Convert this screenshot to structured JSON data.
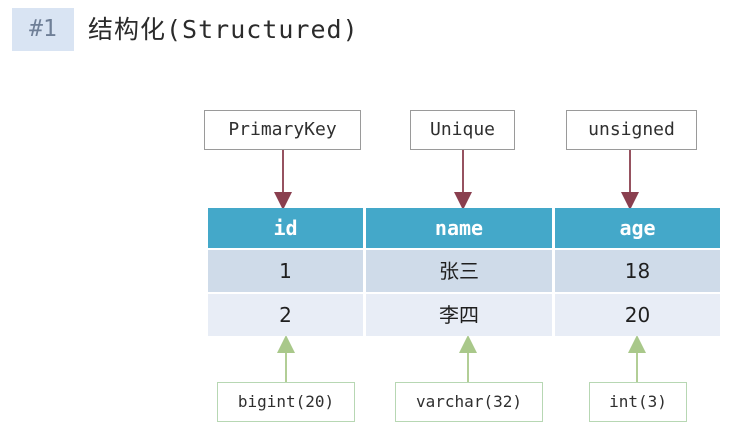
{
  "header": {
    "badge": "#1",
    "title": "结构化(Structured)"
  },
  "constraints": [
    "PrimaryKey",
    "Unique",
    "unsigned"
  ],
  "table": {
    "columns": [
      "id",
      "name",
      "age"
    ],
    "rows": [
      [
        "1",
        "张三",
        "18"
      ],
      [
        "2",
        "李四",
        "20"
      ]
    ]
  },
  "types": [
    "bigint(20)",
    "varchar(32)",
    "int(3)"
  ],
  "colors": {
    "header_fill": "#44a8c9",
    "row1_fill": "#cfdbe9",
    "row2_fill": "#e8edf6",
    "constraint_arrow": "#8a3f4f",
    "type_arrow": "#a9c88a"
  }
}
